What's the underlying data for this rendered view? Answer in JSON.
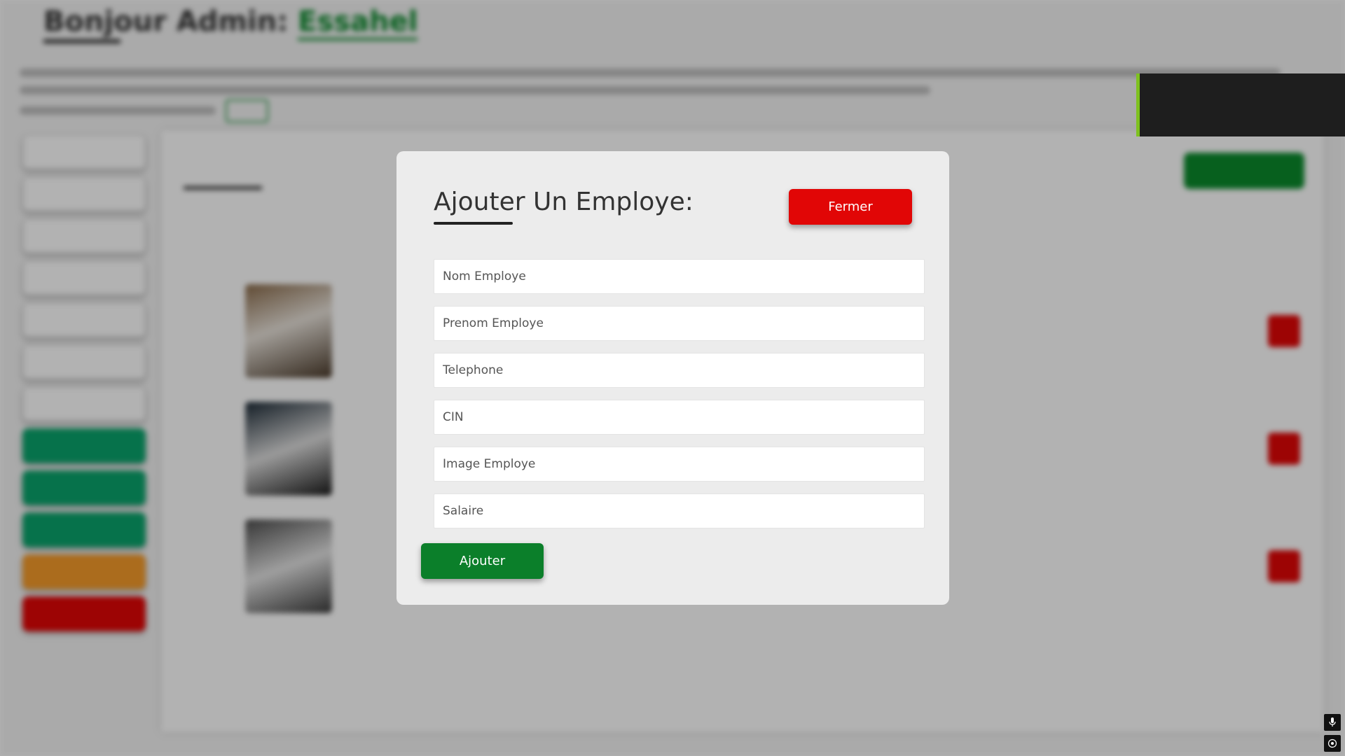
{
  "modal": {
    "title": "Ajouter Un Employe:",
    "close_label": "Fermer",
    "submit_label": "Ajouter",
    "fields": [
      {
        "placeholder": "Nom Employe"
      },
      {
        "placeholder": "Prenom Employe"
      },
      {
        "placeholder": "Telephone"
      },
      {
        "placeholder": "CIN"
      },
      {
        "placeholder": "Image Employe"
      },
      {
        "placeholder": "Salaire"
      }
    ]
  },
  "colors": {
    "close": "#e10606",
    "submit": "#0b7f2a",
    "modal_bg": "#ececec",
    "toast_accent": "#7ec11f"
  },
  "corner_icons": [
    "microphone-icon",
    "target-icon"
  ]
}
